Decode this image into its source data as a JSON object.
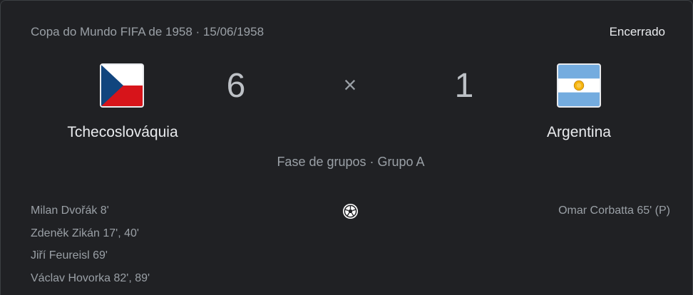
{
  "header": {
    "competition": "Copa do Mundo FIFA de 1958 · 15/06/1958",
    "status": "Encerrado"
  },
  "home": {
    "name": "Tchecoslováquia",
    "score": "6",
    "flag_icon": "czechoslovakia-flag-icon",
    "scorers": [
      "Milan Dvořák 8'",
      "Zdeněk Zikán 17', 40'",
      "Jiří Feureisl 69'",
      "Václav Hovorka 82', 89'"
    ]
  },
  "away": {
    "name": "Argentina",
    "score": "1",
    "flag_icon": "argentina-flag-icon",
    "scorers": [
      "Omar Corbatta 65' (P)"
    ]
  },
  "score_separator": "×",
  "stage": "Fase de grupos · Grupo A",
  "goal_icon": "soccer-ball-icon",
  "colors": {
    "background": "#202124",
    "text_primary": "#e8eaed",
    "text_secondary": "#9aa0a6",
    "cz_red": "#d7141a",
    "cz_blue": "#11457e",
    "ar_blue": "#74acdf",
    "ar_sun": "#f6b40e"
  }
}
